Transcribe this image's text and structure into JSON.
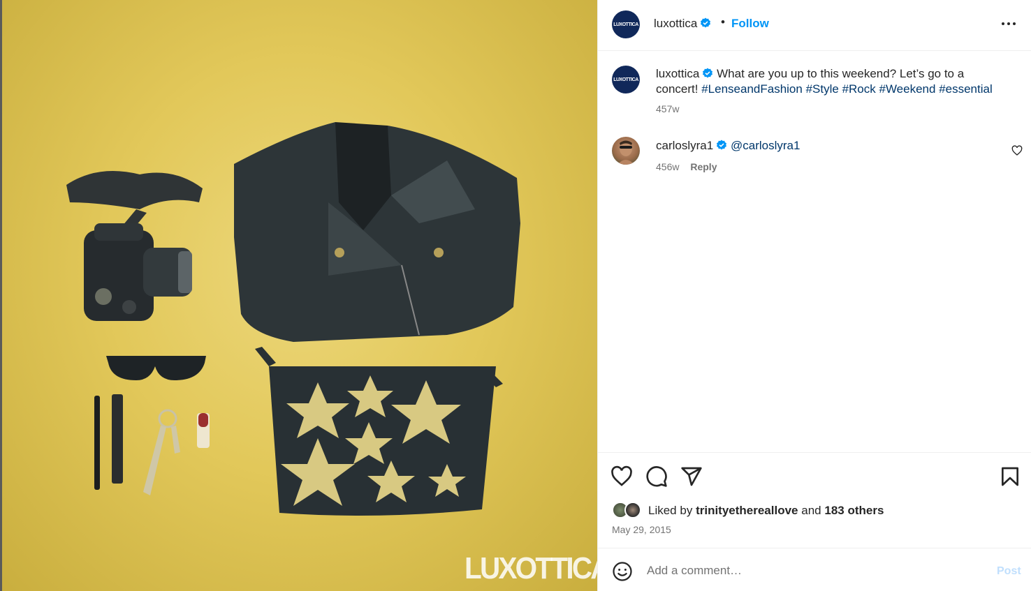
{
  "post": {
    "author": "luxottica",
    "avatar_text": "LUXOTTICA",
    "follow_label": "Follow",
    "separator": "•",
    "more_icon": "more-horizontal-icon",
    "image_watermark": "LUXOTTICA"
  },
  "caption": {
    "username": "luxottica",
    "text": "What are you up to this weekend? Let’s go to a concert!",
    "hashtags": [
      "#LenseandFashion",
      "#Style",
      "#Rock",
      "#Weekend",
      "#essential"
    ],
    "time": "457w"
  },
  "comments": [
    {
      "username": "carloslyra1",
      "text": "@carloslyra1",
      "time": "456w",
      "reply_label": "Reply"
    }
  ],
  "actions": {
    "like_icon": "heart-icon",
    "comment_icon": "comment-icon",
    "share_icon": "send-icon",
    "save_icon": "bookmark-icon"
  },
  "likes": {
    "prefix": "Liked by",
    "user": "trinityethereallove",
    "middle": "and",
    "others": "183 others"
  },
  "date": "May 29, 2015",
  "add_comment": {
    "placeholder": "Add a comment…",
    "post_label": "Post"
  },
  "colors": {
    "link": "#0095f6",
    "hashtag": "#00376b",
    "muted": "#737373",
    "brand_navy": "#10285a"
  }
}
